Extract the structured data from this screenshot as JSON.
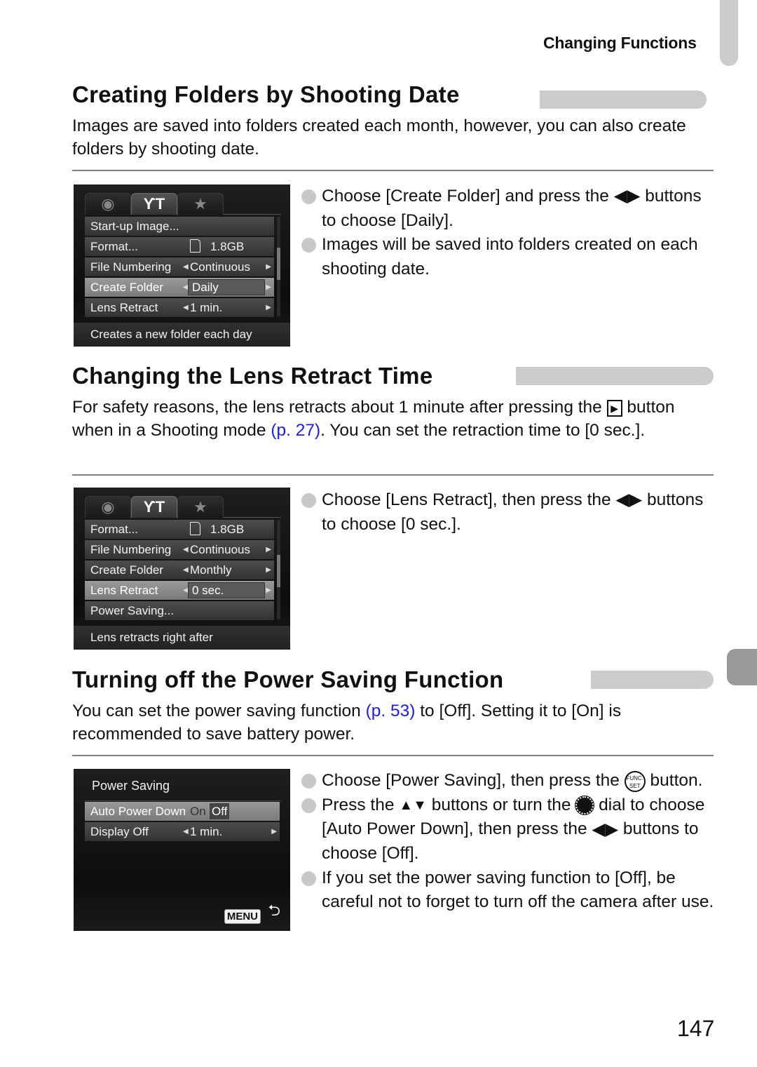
{
  "header": {
    "running_head": "Changing Functions"
  },
  "sections": [
    {
      "title": "Creating Folders by Shooting Date",
      "intro": "Images are saved into folders created each month, however, you can also create folders by shooting date.",
      "steps": [
        {
          "pre": "Choose [Create Folder] and press the ",
          "icon": "left-right-buttons",
          "post": " buttons to choose [Daily]."
        },
        {
          "pre": "Images will be saved into folders created on each shooting date.",
          "icon": "",
          "post": ""
        }
      ],
      "screen": {
        "tabs": [
          {
            "icon": "camera-icon",
            "glyph": "◘"
          },
          {
            "icon": "wrench-hammer-icon",
            "glyph": "ϒT"
          },
          {
            "icon": "star-icon",
            "glyph": "★"
          }
        ],
        "active_tab": 1,
        "rows": [
          {
            "label": "Start-up Image...",
            "value": ""
          },
          {
            "label": "Format...",
            "value": "1.8GB",
            "card": true
          },
          {
            "label": "File Numbering",
            "value": "Continuous",
            "arrows": true
          },
          {
            "label": "Create Folder",
            "value": "Daily",
            "arrows": true,
            "selected": true
          },
          {
            "label": "Lens Retract",
            "value": "1 min.",
            "arrows": true
          }
        ],
        "hint": "Creates a new folder each day"
      }
    },
    {
      "title": "Changing the Lens Retract Time",
      "intro_pre": "For safety reasons, the lens retracts about 1 minute after pressing the ",
      "intro_mid": " button when in a Shooting mode ",
      "intro_link": "(p. 27)",
      "intro_post": ". You can set the retraction time to [0 sec.].",
      "steps": [
        {
          "pre": "Choose [Lens Retract], then press the ",
          "icon": "left-right-buttons",
          "post": " buttons to choose [0 sec.]."
        }
      ],
      "screen": {
        "rows": [
          {
            "label": "Format...",
            "value": "1.8GB",
            "card": true
          },
          {
            "label": "File Numbering",
            "value": "Continuous",
            "arrows": true
          },
          {
            "label": "Create Folder",
            "value": "Monthly",
            "arrows": true
          },
          {
            "label": "Lens Retract",
            "value": "0 sec.",
            "arrows": true,
            "selected": true
          },
          {
            "label": "Power Saving...",
            "value": ""
          }
        ],
        "hint": "Lens retracts right after"
      }
    },
    {
      "title": "Turning off the Power Saving Function",
      "intro_pre": "You can set the power saving function ",
      "intro_link": "(p. 53)",
      "intro_post": " to [Off]. Setting it to [On] is recommended to save battery power.",
      "steps": [
        {
          "pre": "Choose [Power Saving], then press the ",
          "icon": "func-set-button",
          "post": " button."
        },
        {
          "pre": "Press the ",
          "icon": "up-down-buttons",
          "mid": " buttons or turn the ",
          "icon2": "control-dial",
          "post": " dial to choose [Auto Power Down], then press the ",
          "icon3": "left-right-buttons",
          "post2": " buttons to choose [Off]."
        },
        {
          "pre": "If you set the power saving function to [Off], be careful not to forget to turn off the camera after use."
        }
      ],
      "screen": {
        "title": "Power Saving",
        "rows": [
          {
            "label": "Auto Power Down",
            "on": "On",
            "off": "Off",
            "selected": true
          },
          {
            "label": "Display Off",
            "value": "1 min.",
            "arrows": true
          }
        ],
        "menu_label": "MENU",
        "return_glyph": "⮌"
      }
    }
  ],
  "page_number": "147",
  "colors": {
    "link": "#1a1aff",
    "tab_gray": "#cccccc",
    "side_tab": "#999999"
  }
}
